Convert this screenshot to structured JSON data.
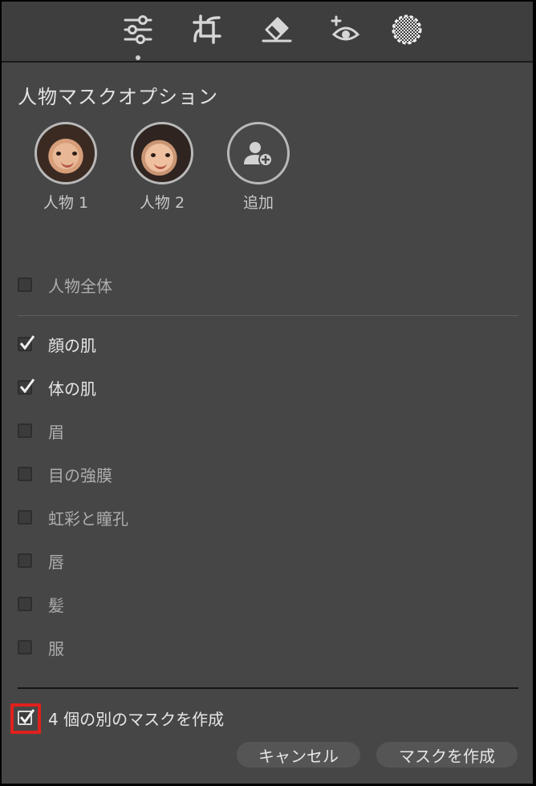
{
  "toolbar": {
    "tools": [
      {
        "icon": "sliders-icon"
      },
      {
        "icon": "crop-icon"
      },
      {
        "icon": "eraser-icon"
      },
      {
        "icon": "red-eye-icon"
      },
      {
        "icon": "mask-circle-icon"
      }
    ],
    "active_index": 0
  },
  "panel": {
    "title": "人物マスクオプション",
    "people": [
      {
        "label": "人物 1"
      },
      {
        "label": "人物 2"
      },
      {
        "label": "追加"
      }
    ],
    "whole_person": {
      "label": "人物全体",
      "checked": false
    },
    "parts": [
      {
        "label": "顔の肌",
        "checked": true
      },
      {
        "label": "体の肌",
        "checked": true
      },
      {
        "label": "眉",
        "checked": false
      },
      {
        "label": "目の強膜",
        "checked": false
      },
      {
        "label": "虹彩と瞳孔",
        "checked": false
      },
      {
        "label": "唇",
        "checked": false
      },
      {
        "label": "髪",
        "checked": false
      },
      {
        "label": "服",
        "checked": false
      }
    ],
    "separate_masks": {
      "label": "4 個の別のマスクを作成",
      "checked": true
    }
  },
  "buttons": {
    "cancel_label": "キャンセル",
    "create_label": "マスクを作成"
  },
  "colors": {
    "panel_bg": "#464646",
    "toolbar_bg": "#3e3e3e",
    "highlight": "#e0201c"
  }
}
